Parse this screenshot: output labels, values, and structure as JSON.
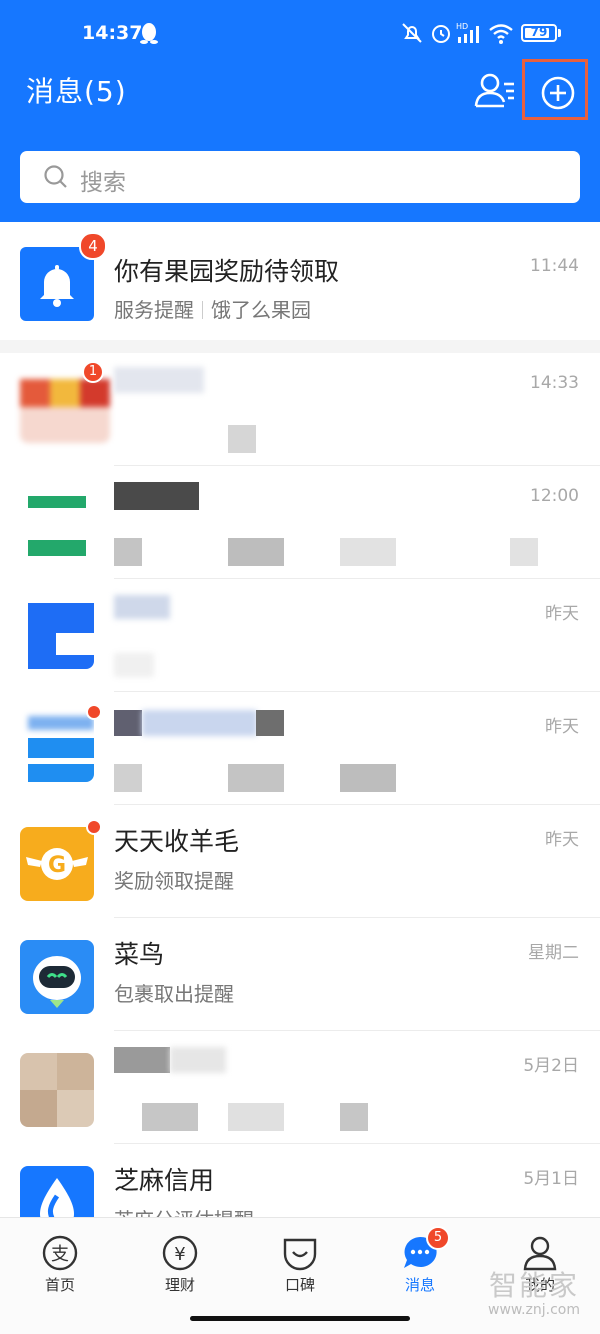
{
  "status_bar": {
    "time": "14:37",
    "battery": "79",
    "battery_level": 0.79
  },
  "header": {
    "title": "消息(5)"
  },
  "search": {
    "placeholder": "搜索"
  },
  "pinned": {
    "title": "你有果园奖励待领取",
    "sub_a": "服务提醒",
    "sub_b": "饿了么果园",
    "time": "11:44",
    "badge": "4"
  },
  "messages": [
    {
      "title": "",
      "subtitle": "",
      "time": "14:33",
      "badge": "1"
    },
    {
      "title": "",
      "subtitle": "",
      "time": "12:00"
    },
    {
      "title": "",
      "subtitle": "",
      "time": "昨天"
    },
    {
      "title": "",
      "subtitle": "",
      "time": "昨天"
    },
    {
      "title": "天天收羊毛",
      "subtitle": "奖励领取提醒",
      "time": "昨天"
    },
    {
      "title": "菜鸟",
      "subtitle": "包裹取出提醒",
      "time": "星期二"
    },
    {
      "title": "",
      "subtitle": "",
      "time": "5月2日"
    },
    {
      "title": "芝麻信用",
      "subtitle": "芝麻分评估提醒",
      "time": "5月1日"
    }
  ],
  "tabs": [
    {
      "label": "首页"
    },
    {
      "label": "理财"
    },
    {
      "label": "口碑"
    },
    {
      "label": "消息",
      "badge": "5"
    },
    {
      "label": "我的"
    }
  ],
  "watermark": {
    "big": "智能家",
    "small": "www.znj.com"
  },
  "colors": {
    "brand_blue": "#1677ff",
    "badge_red": "#f0482a",
    "highlight_orange": "#e8603d"
  }
}
